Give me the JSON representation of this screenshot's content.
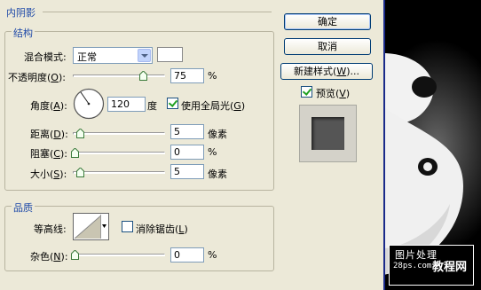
{
  "inner_shadow": {
    "section_label": "内阴影",
    "structure": {
      "group_label": "结构",
      "blend_mode": {
        "label": "混合模式:",
        "value": "正常"
      },
      "opacity": {
        "label": "不透明度(",
        "accel": "O",
        "label_end": "):",
        "value": "75",
        "unit": "%",
        "level": 0.75
      },
      "angle": {
        "label": "角度(",
        "accel": "A",
        "label_end": "):",
        "value": "120",
        "unit": "度",
        "global_light": {
          "label": "使用全局光(",
          "accel": "G",
          "label_end": ")",
          "checked": true
        }
      },
      "distance": {
        "label": "距离(",
        "accel": "D",
        "label_end": "):",
        "value": "5",
        "unit": "像素",
        "level": 0.02
      },
      "choke": {
        "label": "阻塞(",
        "accel": "C",
        "label_end": "):",
        "value": "0",
        "unit": "%",
        "level": 0.0
      },
      "size": {
        "label": "大小(",
        "accel": "S",
        "label_end": "):",
        "value": "5",
        "unit": "像素",
        "level": 0.02
      }
    },
    "quality": {
      "group_label": "品质",
      "contour": {
        "label": "等高线:"
      },
      "anti_alias": {
        "label": "消除锯齿(",
        "accel": "L",
        "label_end": ")",
        "checked": false
      },
      "noise": {
        "label": "杂色(",
        "accel": "N",
        "label_end": "):",
        "value": "0",
        "unit": "%",
        "level": 0.0
      }
    }
  },
  "buttons": {
    "ok": "确定",
    "cancel": "取消",
    "new_style_pre": "新建样式(",
    "new_style_accel": "W",
    "new_style_post": ")...",
    "preview": {
      "label": "预览(",
      "accel": "V",
      "label_end": ")",
      "checked": true
    }
  },
  "watermark": {
    "line1": "图片处理",
    "line2": "28ps.com",
    "line3": "教程网"
  },
  "colors": {
    "accent_text": "#1f4aa8",
    "dialog_bg": "#ece9d8",
    "canvas_bg": "#000000"
  }
}
